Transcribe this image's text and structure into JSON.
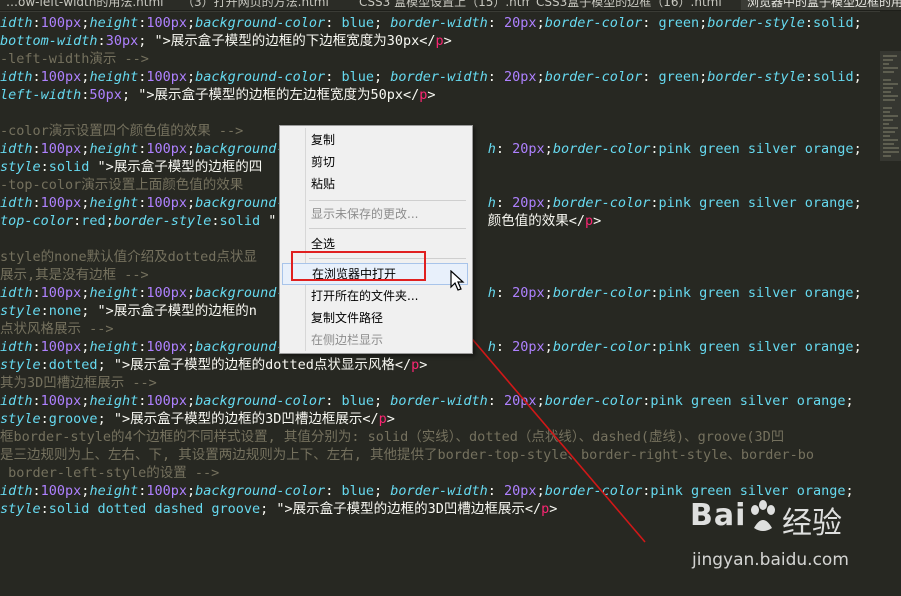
{
  "tabs": [
    {
      "label": "…ow-left-width的用法.html"
    },
    {
      "label": "（3）打开网页的方法.html"
    },
    {
      "label": "CSS3 盒模型设置上（15）.html"
    },
    {
      "label": "CSS3盒子模型的边框（16）.html"
    },
    {
      "label": "浏览器中的盒子模型边框的用法.html"
    }
  ],
  "code_lines": [
    [
      {
        "t": "idth",
        "c": "attr"
      },
      {
        "t": ":",
        "c": "punc"
      },
      {
        "t": "100px",
        "c": "num"
      },
      {
        "t": ";",
        "c": "punc"
      },
      {
        "t": "height",
        "c": "attr"
      },
      {
        "t": ":",
        "c": "punc"
      },
      {
        "t": "100px",
        "c": "num"
      },
      {
        "t": ";",
        "c": "punc"
      },
      {
        "t": "background-color",
        "c": "attr"
      },
      {
        "t": ": ",
        "c": "punc"
      },
      {
        "t": "blue",
        "c": "val"
      },
      {
        "t": "; ",
        "c": "punc"
      },
      {
        "t": "border-width",
        "c": "attr"
      },
      {
        "t": ": ",
        "c": "punc"
      },
      {
        "t": "20px",
        "c": "num"
      },
      {
        "t": ";",
        "c": "punc"
      },
      {
        "t": "border-color",
        "c": "attr"
      },
      {
        "t": ": ",
        "c": "punc"
      },
      {
        "t": "green",
        "c": "val"
      },
      {
        "t": ";",
        "c": "punc"
      },
      {
        "t": "border-style",
        "c": "attr"
      },
      {
        "t": ":",
        "c": "punc"
      },
      {
        "t": "solid",
        "c": "val"
      },
      {
        "t": ";",
        "c": "punc"
      }
    ],
    [
      {
        "t": "bottom-width",
        "c": "attr"
      },
      {
        "t": ":",
        "c": "punc"
      },
      {
        "t": "30px",
        "c": "num"
      },
      {
        "t": "; \">",
        "c": "punc"
      },
      {
        "t": "展示盒子模型的边框的下边框宽度为30px",
        "c": "txt"
      },
      {
        "t": "</",
        "c": "punc"
      },
      {
        "t": "p",
        "c": "tag"
      },
      {
        "t": ">",
        "c": "punc"
      }
    ],
    [
      {
        "t": "-left-width演示 -->",
        "c": "com"
      }
    ],
    [
      {
        "t": "idth",
        "c": "attr"
      },
      {
        "t": ":",
        "c": "punc"
      },
      {
        "t": "100px",
        "c": "num"
      },
      {
        "t": ";",
        "c": "punc"
      },
      {
        "t": "height",
        "c": "attr"
      },
      {
        "t": ":",
        "c": "punc"
      },
      {
        "t": "100px",
        "c": "num"
      },
      {
        "t": ";",
        "c": "punc"
      },
      {
        "t": "background-color",
        "c": "attr"
      },
      {
        "t": ": ",
        "c": "punc"
      },
      {
        "t": "blue",
        "c": "val"
      },
      {
        "t": "; ",
        "c": "punc"
      },
      {
        "t": "border-width",
        "c": "attr"
      },
      {
        "t": ": ",
        "c": "punc"
      },
      {
        "t": "20px",
        "c": "num"
      },
      {
        "t": ";",
        "c": "punc"
      },
      {
        "t": "border-color",
        "c": "attr"
      },
      {
        "t": ": ",
        "c": "punc"
      },
      {
        "t": "green",
        "c": "val"
      },
      {
        "t": ";",
        "c": "punc"
      },
      {
        "t": "border-style",
        "c": "attr"
      },
      {
        "t": ":",
        "c": "punc"
      },
      {
        "t": "solid",
        "c": "val"
      },
      {
        "t": ";",
        "c": "punc"
      }
    ],
    [
      {
        "t": "left-width",
        "c": "attr"
      },
      {
        "t": ":",
        "c": "punc"
      },
      {
        "t": "50px",
        "c": "num"
      },
      {
        "t": "; \">",
        "c": "punc"
      },
      {
        "t": "展示盒子模型的边框的左边框宽度为50px",
        "c": "txt"
      },
      {
        "t": "</",
        "c": "punc"
      },
      {
        "t": "p",
        "c": "tag"
      },
      {
        "t": ">",
        "c": "punc"
      }
    ],
    [],
    [
      {
        "t": "-color演示设置四个颜色值的效果 -->",
        "c": "com"
      }
    ],
    [
      {
        "t": "idth",
        "c": "attr"
      },
      {
        "t": ":",
        "c": "punc"
      },
      {
        "t": "100px",
        "c": "num"
      },
      {
        "t": ";",
        "c": "punc"
      },
      {
        "t": "height",
        "c": "attr"
      },
      {
        "t": ":",
        "c": "punc"
      },
      {
        "t": "100px",
        "c": "num"
      },
      {
        "t": ";",
        "c": "punc"
      },
      {
        "t": "background-",
        "c": "attr"
      },
      {
        "t": "                         ",
        "c": "punc"
      },
      {
        "t": "h",
        "c": "attr"
      },
      {
        "t": ": ",
        "c": "punc"
      },
      {
        "t": "20px",
        "c": "num"
      },
      {
        "t": ";",
        "c": "punc"
      },
      {
        "t": "border-color",
        "c": "attr"
      },
      {
        "t": ":",
        "c": "punc"
      },
      {
        "t": "pink green silver orange",
        "c": "val"
      },
      {
        "t": ";",
        "c": "punc"
      }
    ],
    [
      {
        "t": "style",
        "c": "attr"
      },
      {
        "t": ":",
        "c": "punc"
      },
      {
        "t": "solid",
        "c": "val"
      },
      {
        "t": " \">",
        "c": "punc"
      },
      {
        "t": "展示盒子模型的边框的四",
        "c": "txt"
      }
    ],
    [
      {
        "t": "-top-color演示设置上面颜色值的效果",
        "c": "com"
      }
    ],
    [
      {
        "t": "idth",
        "c": "attr"
      },
      {
        "t": ":",
        "c": "punc"
      },
      {
        "t": "100px",
        "c": "num"
      },
      {
        "t": ";",
        "c": "punc"
      },
      {
        "t": "height",
        "c": "attr"
      },
      {
        "t": ":",
        "c": "punc"
      },
      {
        "t": "100px",
        "c": "num"
      },
      {
        "t": ";",
        "c": "punc"
      },
      {
        "t": "background-",
        "c": "attr"
      },
      {
        "t": "                         ",
        "c": "punc"
      },
      {
        "t": "h",
        "c": "attr"
      },
      {
        "t": ": ",
        "c": "punc"
      },
      {
        "t": "20px",
        "c": "num"
      },
      {
        "t": ";",
        "c": "punc"
      },
      {
        "t": "border-color",
        "c": "attr"
      },
      {
        "t": ":",
        "c": "punc"
      },
      {
        "t": "pink green silver orange",
        "c": "val"
      },
      {
        "t": ";",
        "c": "punc"
      }
    ],
    [
      {
        "t": "top-color",
        "c": "attr"
      },
      {
        "t": ":",
        "c": "punc"
      },
      {
        "t": "red",
        "c": "val"
      },
      {
        "t": ";",
        "c": "punc"
      },
      {
        "t": "border-style",
        "c": "attr"
      },
      {
        "t": ":",
        "c": "punc"
      },
      {
        "t": "solid",
        "c": "val"
      },
      {
        "t": " \"",
        "c": "punc"
      },
      {
        "t": "                          ",
        "c": "punc"
      },
      {
        "t": "颜色值的效果",
        "c": "txt"
      },
      {
        "t": "</",
        "c": "punc"
      },
      {
        "t": "p",
        "c": "tag"
      },
      {
        "t": ">",
        "c": "punc"
      }
    ],
    [],
    [
      {
        "t": "style的none默认值介绍及dotted点状显",
        "c": "com"
      }
    ],
    [
      {
        "t": "展示,其是没有边框 -->",
        "c": "com"
      }
    ],
    [
      {
        "t": "idth",
        "c": "attr"
      },
      {
        "t": ":",
        "c": "punc"
      },
      {
        "t": "100px",
        "c": "num"
      },
      {
        "t": ";",
        "c": "punc"
      },
      {
        "t": "height",
        "c": "attr"
      },
      {
        "t": ":",
        "c": "punc"
      },
      {
        "t": "100px",
        "c": "num"
      },
      {
        "t": ";",
        "c": "punc"
      },
      {
        "t": "background-",
        "c": "attr"
      },
      {
        "t": "                         ",
        "c": "punc"
      },
      {
        "t": "h",
        "c": "attr"
      },
      {
        "t": ": ",
        "c": "punc"
      },
      {
        "t": "20px",
        "c": "num"
      },
      {
        "t": ";",
        "c": "punc"
      },
      {
        "t": "border-color",
        "c": "attr"
      },
      {
        "t": ":",
        "c": "punc"
      },
      {
        "t": "pink green silver orange",
        "c": "val"
      },
      {
        "t": ";",
        "c": "punc"
      }
    ],
    [
      {
        "t": "style",
        "c": "attr"
      },
      {
        "t": ":",
        "c": "punc"
      },
      {
        "t": "none",
        "c": "val"
      },
      {
        "t": "; \">",
        "c": "punc"
      },
      {
        "t": "展示盒子模型的边框的n",
        "c": "txt"
      }
    ],
    [
      {
        "t": "点状风格展示 -->",
        "c": "com"
      }
    ],
    [
      {
        "t": "idth",
        "c": "attr"
      },
      {
        "t": ":",
        "c": "punc"
      },
      {
        "t": "100px",
        "c": "num"
      },
      {
        "t": ";",
        "c": "punc"
      },
      {
        "t": "height",
        "c": "attr"
      },
      {
        "t": ":",
        "c": "punc"
      },
      {
        "t": "100px",
        "c": "num"
      },
      {
        "t": ";",
        "c": "punc"
      },
      {
        "t": "background-",
        "c": "attr"
      },
      {
        "t": "                         ",
        "c": "punc"
      },
      {
        "t": "h",
        "c": "attr"
      },
      {
        "t": ": ",
        "c": "punc"
      },
      {
        "t": "20px",
        "c": "num"
      },
      {
        "t": ";",
        "c": "punc"
      },
      {
        "t": "border-color",
        "c": "attr"
      },
      {
        "t": ":",
        "c": "punc"
      },
      {
        "t": "pink green silver orange",
        "c": "val"
      },
      {
        "t": ";",
        "c": "punc"
      }
    ],
    [
      {
        "t": "style",
        "c": "attr"
      },
      {
        "t": ":",
        "c": "punc"
      },
      {
        "t": "dotted",
        "c": "val"
      },
      {
        "t": "; \">",
        "c": "punc"
      },
      {
        "t": "展示盒子模型的边框的dotted点状显示风格",
        "c": "txt"
      },
      {
        "t": "</",
        "c": "punc"
      },
      {
        "t": "p",
        "c": "tag"
      },
      {
        "t": ">",
        "c": "punc"
      }
    ],
    [
      {
        "t": "其为3D凹槽边框展示 -->",
        "c": "com"
      }
    ],
    [
      {
        "t": "idth",
        "c": "attr"
      },
      {
        "t": ":",
        "c": "punc"
      },
      {
        "t": "100px",
        "c": "num"
      },
      {
        "t": ";",
        "c": "punc"
      },
      {
        "t": "height",
        "c": "attr"
      },
      {
        "t": ":",
        "c": "punc"
      },
      {
        "t": "100px",
        "c": "num"
      },
      {
        "t": ";",
        "c": "punc"
      },
      {
        "t": "background-color",
        "c": "attr"
      },
      {
        "t": ": ",
        "c": "punc"
      },
      {
        "t": "blue",
        "c": "val"
      },
      {
        "t": "; ",
        "c": "punc"
      },
      {
        "t": "border-width",
        "c": "attr"
      },
      {
        "t": ": ",
        "c": "punc"
      },
      {
        "t": "20px",
        "c": "num"
      },
      {
        "t": ";",
        "c": "punc"
      },
      {
        "t": "border-color",
        "c": "attr"
      },
      {
        "t": ":",
        "c": "punc"
      },
      {
        "t": "pink green silver orange",
        "c": "val"
      },
      {
        "t": ";",
        "c": "punc"
      }
    ],
    [
      {
        "t": "style",
        "c": "attr"
      },
      {
        "t": ":",
        "c": "punc"
      },
      {
        "t": "groove",
        "c": "val"
      },
      {
        "t": "; \">",
        "c": "punc"
      },
      {
        "t": "展示盒子模型的边框的3D凹槽边框展示",
        "c": "txt"
      },
      {
        "t": "</",
        "c": "punc"
      },
      {
        "t": "p",
        "c": "tag"
      },
      {
        "t": ">",
        "c": "punc"
      }
    ],
    [
      {
        "t": "框border-style的4个边框的不同样式设置, 其值分别为: solid（实线）、dotted（点状线）、dashed(虚线)、groove(3D凹",
        "c": "com"
      }
    ],
    [
      {
        "t": "是三边规则为上、左右、下, 其设置两边规则为上下、左右, 其他提供了border-top-style、border-right-style、border-bo",
        "c": "com"
      }
    ],
    [
      {
        "t": " border-left-style的设置 -->",
        "c": "com"
      }
    ],
    [
      {
        "t": "idth",
        "c": "attr"
      },
      {
        "t": ":",
        "c": "punc"
      },
      {
        "t": "100px",
        "c": "num"
      },
      {
        "t": ";",
        "c": "punc"
      },
      {
        "t": "height",
        "c": "attr"
      },
      {
        "t": ":",
        "c": "punc"
      },
      {
        "t": "100px",
        "c": "num"
      },
      {
        "t": ";",
        "c": "punc"
      },
      {
        "t": "background-color",
        "c": "attr"
      },
      {
        "t": ": ",
        "c": "punc"
      },
      {
        "t": "blue",
        "c": "val"
      },
      {
        "t": "; ",
        "c": "punc"
      },
      {
        "t": "border-width",
        "c": "attr"
      },
      {
        "t": ": ",
        "c": "punc"
      },
      {
        "t": "20px",
        "c": "num"
      },
      {
        "t": ";",
        "c": "punc"
      },
      {
        "t": "border-color",
        "c": "attr"
      },
      {
        "t": ":",
        "c": "punc"
      },
      {
        "t": "pink green silver orange",
        "c": "val"
      },
      {
        "t": ";",
        "c": "punc"
      }
    ],
    [
      {
        "t": "style",
        "c": "attr"
      },
      {
        "t": ":",
        "c": "punc"
      },
      {
        "t": "solid dotted dashed groove",
        "c": "val"
      },
      {
        "t": "; \">",
        "c": "punc"
      },
      {
        "t": "展示盒子模型的边框的3D凹槽边框展示",
        "c": "txt"
      },
      {
        "t": "</",
        "c": "punc"
      },
      {
        "t": "p",
        "c": "tag"
      },
      {
        "t": ">",
        "c": "punc"
      }
    ]
  ],
  "context_menu": {
    "items": [
      {
        "label": "复制",
        "disabled": false
      },
      {
        "label": "剪切",
        "disabled": false
      },
      {
        "label": "粘贴",
        "disabled": false
      },
      {
        "label": "显示未保存的更改...",
        "disabled": true
      },
      {
        "label": "全选",
        "disabled": false
      },
      {
        "label": "在浏览器中打开",
        "disabled": false,
        "hover": true
      },
      {
        "label": "打开所在的文件夹...",
        "disabled": false
      },
      {
        "label": "复制文件路径",
        "disabled": false
      },
      {
        "label": "在侧边栏显示",
        "disabled": true
      }
    ]
  },
  "watermark": {
    "brand_left": "Bai",
    "brand_right": "经验",
    "url": "jingyan.baidu.com"
  },
  "colors": {
    "background": "#272822",
    "attr": "#66d9ef",
    "number": "#ae81ff",
    "comment": "#75715e",
    "tag": "#f92672",
    "highlight_box": "#e02020"
  }
}
